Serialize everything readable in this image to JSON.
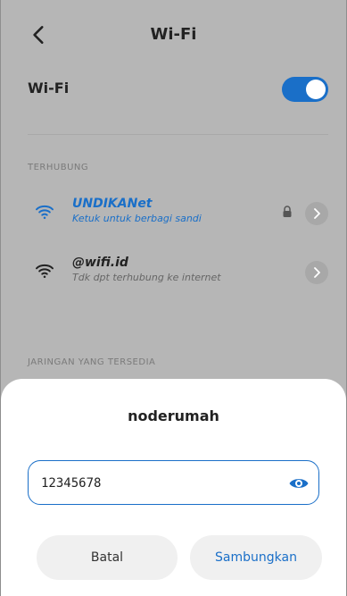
{
  "app": {
    "title": "Wi-Fi"
  },
  "settings": {
    "wifi_label": "Wi-Fi",
    "wifi_enabled": true
  },
  "sections": {
    "connected_header": "TERHUBUNG",
    "available_header": "JARINGAN YANG TERSEDIA"
  },
  "networks": [
    {
      "name": "UNDIKANet",
      "status": "Ketuk untuk berbagi sandi",
      "locked": true,
      "color": "#1a6fc8"
    },
    {
      "name": "@wifi.id",
      "status": "Tdk dpt terhubung ke internet",
      "locked": false,
      "color": "#222222"
    }
  ],
  "dialog": {
    "title": "noderumah",
    "password_value": "12345678",
    "cancel_label": "Batal",
    "connect_label": "Sambungkan"
  },
  "colors": {
    "accent": "#1a6fc8",
    "dim_background": "#b6b6b6"
  },
  "icons": {
    "back": "chevron-left-icon",
    "wifi": "wifi-icon",
    "lock": "lock-icon",
    "detail": "chevron-right-icon",
    "show_password": "eye-icon"
  }
}
